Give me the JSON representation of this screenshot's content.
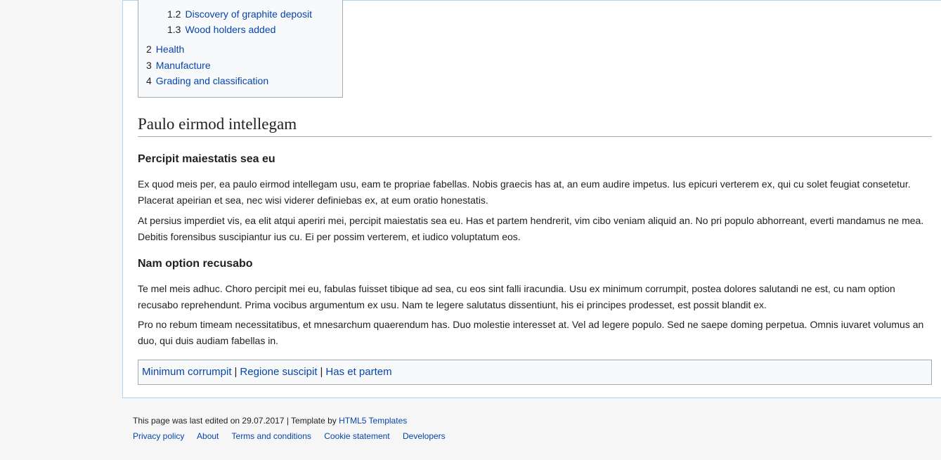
{
  "toc": {
    "items": [
      {
        "num": "1.2",
        "label": "Discovery of graphite deposit"
      },
      {
        "num": "1.3",
        "label": "Wood holders added"
      },
      {
        "num": "2",
        "label": "Health"
      },
      {
        "num": "3",
        "label": "Manufacture"
      },
      {
        "num": "4",
        "label": "Grading and classification"
      }
    ]
  },
  "article": {
    "heading": "Paulo eirmod intellegam",
    "sections": [
      {
        "title": "Percipit maiestatis sea eu",
        "paragraphs": [
          "Ex quod meis per, ea paulo eirmod intellegam usu, eam te propriae fabellas. Nobis graecis has at, an eum audire impetus. Ius epicuri verterem ex, qui cu solet feugiat consetetur. Placerat apeirian et sea, nec wisi viderer definiebas ex, at eum oratio honestatis.",
          "At persius imperdiet vis, ea elit atqui aperiri mei, percipit maiestatis sea eu. Has et partem hendrerit, vim cibo veniam aliquid an. No pri populo abhorreant, everti mandamus ne mea. Debitis forensibus suscipiantur ius cu. Ei per possim verterem, et iudico voluptatum eos."
        ]
      },
      {
        "title": "Nam option recusabo",
        "paragraphs": [
          "Te mel meis adhuc. Choro percipit mei eu, fabulas fuisset tibique ad sea, cu eos sint falli iracundia. Usu ex minimum corrumpit, postea dolores salutandi ne est, cu nam option recusabo reprehendunt. Prima vocibus argumentum ex usu. Nam te legere salutatus dissentiunt, his ei principes prodesset, est possit blandit ex.",
          "Pro no rebum timeam necessitatibus, et mnesarchum quaerendum has. Duo molestie interesset at. Vel ad legere populo. Sed ne saepe doming perpetua. Omnis iuvaret volumus an duo, qui duis audiam fabellas in."
        ]
      }
    ]
  },
  "categories": {
    "links": [
      "Minimum corrumpit",
      "Regione suscipit",
      "Has et partem"
    ],
    "separator": "|"
  },
  "footer": {
    "last_edited_text": "This page was last edited on 29.07.2017 | Template by ",
    "template_link": "HTML5 Templates",
    "links": [
      "Privacy policy",
      "About",
      "Terms and conditions",
      "Cookie statement",
      "Developers"
    ]
  }
}
